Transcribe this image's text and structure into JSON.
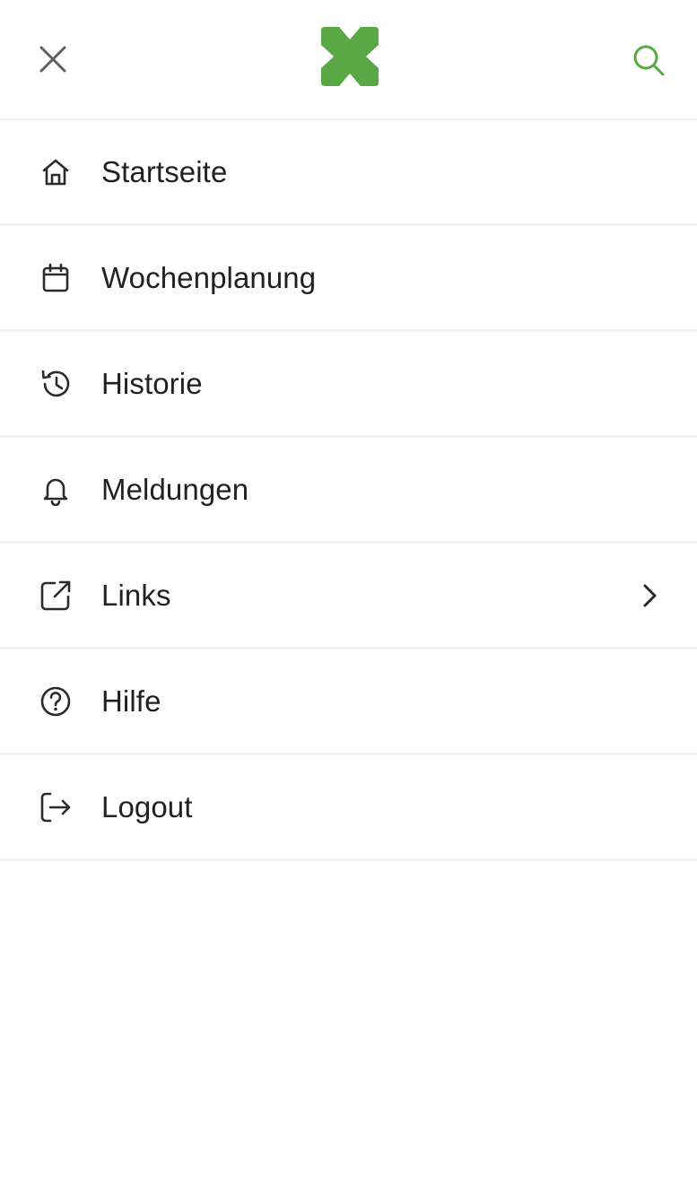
{
  "colors": {
    "brand_green": "#5aa845",
    "icon_dark": "#2b2b2b",
    "close_gray": "#5f5f5f",
    "divider": "#f1f1f1"
  },
  "header": {
    "close_icon": "close-icon",
    "logo_icon": "brand-x-logo",
    "search_icon": "search-icon"
  },
  "menu": {
    "items": [
      {
        "label": "Startseite",
        "icon": "home-icon"
      },
      {
        "label": "Wochenplanung",
        "icon": "calendar-icon"
      },
      {
        "label": "Historie",
        "icon": "history-icon"
      },
      {
        "label": "Meldungen",
        "icon": "bell-icon"
      },
      {
        "label": "Links",
        "icon": "external-link-icon",
        "has_submenu": true
      },
      {
        "label": "Hilfe",
        "icon": "help-circle-icon"
      },
      {
        "label": "Logout",
        "icon": "logout-icon"
      }
    ]
  }
}
